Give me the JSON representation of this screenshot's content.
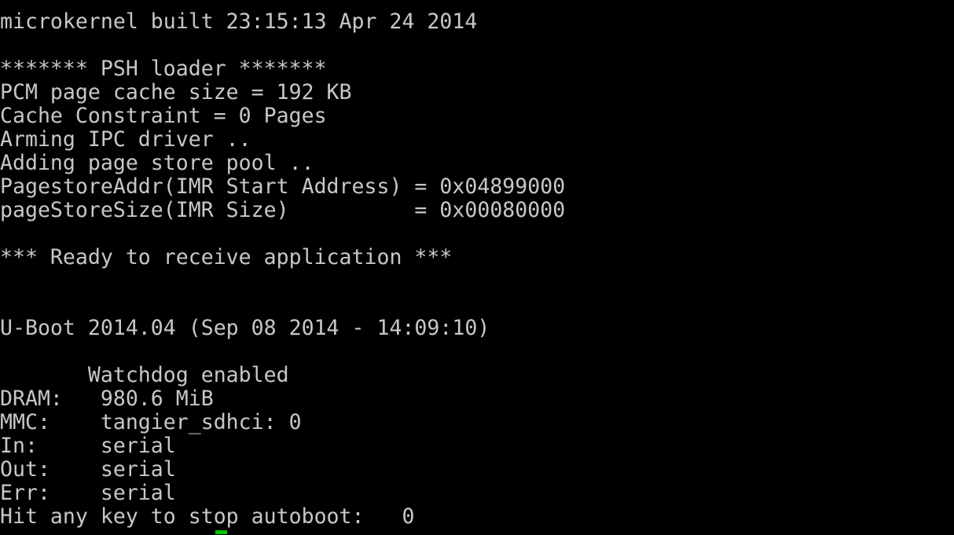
{
  "console": {
    "background_color": "#000000",
    "text_color": "#c6c8c8",
    "cursor_color": "#00c400",
    "lines": [
      "microkernel built 23:15:13 Apr 24 2014",
      "",
      "******* PSH loader *******",
      "PCM page cache size = 192 KB",
      "Cache Constraint = 0 Pages",
      "Arming IPC driver ..",
      "Adding page store pool ..",
      "PagestoreAddr(IMR Start Address) = 0x04899000",
      "pageStoreSize(IMR Size)          = 0x00080000",
      "",
      "*** Ready to receive application ***",
      "",
      "",
      "U-Boot 2014.04 (Sep 08 2014 - 14:09:10)",
      "",
      "       Watchdog enabled",
      "DRAM:   980.6 MiB",
      "MMC:    tangier_sdhci: 0",
      "In:     serial",
      "Out:    serial",
      "Err:    serial",
      "Hit any key to stop autoboot:   0"
    ]
  }
}
